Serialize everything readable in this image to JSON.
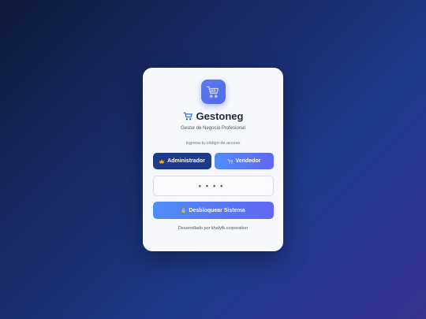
{
  "app": {
    "icon": "shopping-cart-icon",
    "title": "Gestoneg",
    "subtitle": "Gestor de Negocio Profesional"
  },
  "login": {
    "prompt": "Ingresa tu código de acceso",
    "roles": [
      {
        "label": "Administrador",
        "icon": "crown-icon"
      },
      {
        "label": "Vendedor",
        "icon": "shopping-cart-icon"
      }
    ],
    "pin_value": "••••",
    "unlock_label": "Desbloquear Sistema",
    "unlock_icon": "lock-icon"
  },
  "footer": {
    "text": "Desarrollado por khalyfk.corporation"
  },
  "colors": {
    "accent": "#4f6ae6",
    "admin_button": "#1e3a8a",
    "gradient_start": "#4f8df5",
    "gradient_end": "#6366f1"
  }
}
